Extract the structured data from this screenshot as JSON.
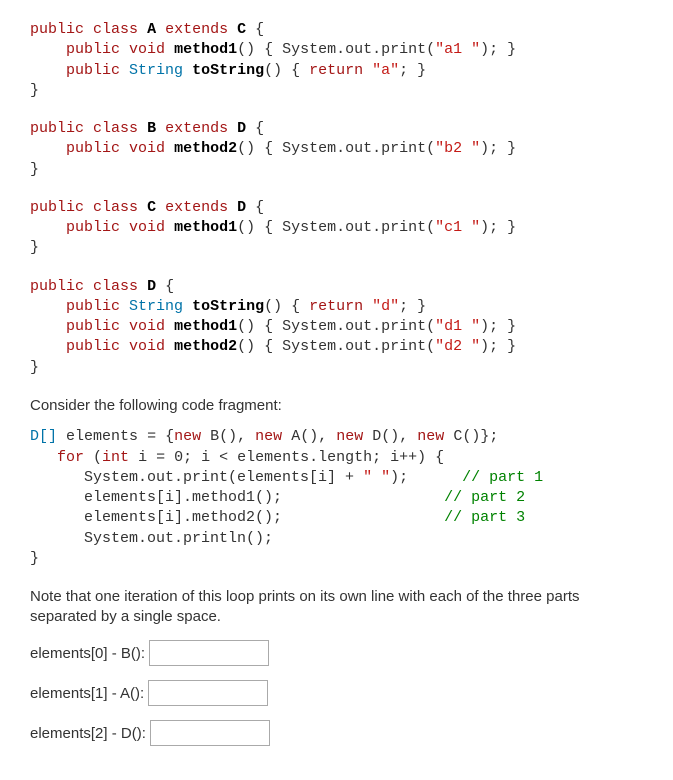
{
  "code": {
    "classA": {
      "decl_public": "public",
      "decl_class": "class",
      "name": "A",
      "extends_kw": "extends",
      "superclass": "C",
      "m1_public": "public",
      "m1_void": "void",
      "m1_name": "method1",
      "m1_body_call": "System.out.print",
      "m1_body_arg": "\"a1 \"",
      "m2_public": "public",
      "m2_type": "String",
      "m2_name": "toString",
      "m2_return": "return",
      "m2_value": "\"a\""
    },
    "classB": {
      "decl_public": "public",
      "decl_class": "class",
      "name": "B",
      "extends_kw": "extends",
      "superclass": "D",
      "m1_public": "public",
      "m1_void": "void",
      "m1_name": "method2",
      "m1_body_call": "System.out.print",
      "m1_body_arg": "\"b2 \""
    },
    "classC": {
      "decl_public": "public",
      "decl_class": "class",
      "name": "C",
      "extends_kw": "extends",
      "superclass": "D",
      "m1_public": "public",
      "m1_void": "void",
      "m1_name": "method1",
      "m1_body_call": "System.out.print",
      "m1_body_arg": "\"c1 \""
    },
    "classD": {
      "decl_public": "public",
      "decl_class": "class",
      "name": "D",
      "m1_public": "public",
      "m1_type": "String",
      "m1_name": "toString",
      "m1_return": "return",
      "m1_value": "\"d\"",
      "m2_public": "public",
      "m2_void": "void",
      "m2_name": "method1",
      "m2_call": "System.out.print",
      "m2_arg": "\"d1 \"",
      "m3_public": "public",
      "m3_void": "void",
      "m3_name": "method2",
      "m3_call": "System.out.print",
      "m3_arg": "\"d2 \""
    }
  },
  "prose": {
    "consider": "Consider the following code fragment:",
    "note": "Note that one iteration of this loop prints on its own line with each of the three parts separated by a single space."
  },
  "fragment": {
    "line1_type": "D[]",
    "line1_var": "elements",
    "line1_eq": "=",
    "line1_new1": "new",
    "line1_B": "B()",
    "line1_new2": "new",
    "line1_A": "A()",
    "line1_new3": "new",
    "line1_D": "D()",
    "line1_new4": "new",
    "line1_C": "C()",
    "for_kw": "for",
    "for_int": "int",
    "for_init": "i = 0; i < elements.length; i++",
    "p1_call": "System.out.print(elements[i] + ",
    "p1_str": "\" \"",
    "p1_close": ");",
    "p1_cmt": "// part 1",
    "p2": "elements[i].method1();",
    "p2_cmt": "// part 2",
    "p3": "elements[i].method2();",
    "p3_cmt": "// part 3",
    "p4": "System.out.println();"
  },
  "questions": {
    "q0_label": "elements[0] - B():",
    "q0_value": "",
    "q1_label": "elements[1] - A():",
    "q1_value": "",
    "q2_label": "elements[2] - D():",
    "q2_value": ""
  }
}
